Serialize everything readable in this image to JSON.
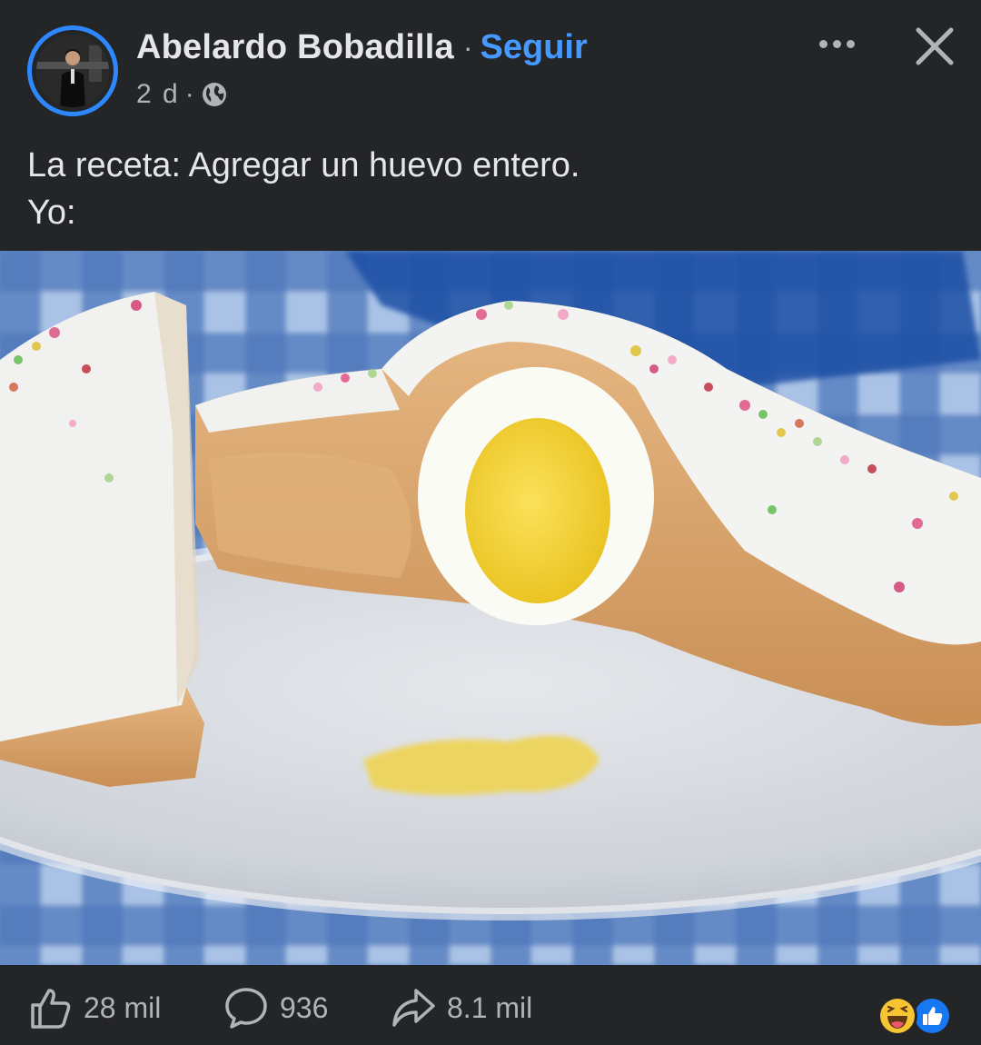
{
  "post": {
    "author": {
      "name": "Abelardo Bobadilla",
      "follow_label": "Seguir",
      "separator": "·"
    },
    "meta": {
      "time": "2 d",
      "separator": "·",
      "audience_icon": "globe-icon"
    },
    "caption": "La receta: Agregar un huevo entero.\nYo:",
    "header_icons": [
      "more-options-icon",
      "close-icon"
    ]
  },
  "media": {
    "type": "photo",
    "subject": "sweet bread with icing and sprinkles, cut open showing a whole boiled egg inside",
    "colors": {
      "tablecloth": "#5f87c4",
      "plate": "#d9dde3",
      "bread": "#d8a56c",
      "icing": "#f1f1ef",
      "egg_white": "#fbfbf6",
      "yolk": "#f2d33a"
    }
  },
  "actions": {
    "like": {
      "count": "28 mil",
      "icon": "thumbs-up-icon"
    },
    "comment": {
      "count": "936",
      "icon": "comment-bubble-icon"
    },
    "share": {
      "count": "8.1 mil",
      "icon": "share-arrow-icon"
    },
    "reactions": [
      "haha-reaction-icon",
      "like-reaction-icon"
    ]
  },
  "theme": {
    "background": "#242526",
    "text_primary": "#e4e6eb",
    "text_secondary": "#b0b3b8",
    "accent": "#4599ff",
    "avatar_ring": "#2d88ff"
  }
}
